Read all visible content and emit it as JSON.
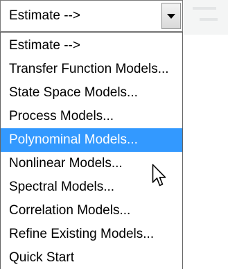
{
  "combo": {
    "value": "Estimate -->",
    "button_icon": "chevron-down-icon"
  },
  "dropdown": {
    "items": [
      {
        "label": "Estimate -->"
      },
      {
        "label": "Transfer Function Models..."
      },
      {
        "label": "State Space Models..."
      },
      {
        "label": "Process Models..."
      },
      {
        "label": "Polynominal Models...",
        "highlighted": true
      },
      {
        "label": "Nonlinear Models..."
      },
      {
        "label": "Spectral Models..."
      },
      {
        "label": "Correlation Models..."
      },
      {
        "label": "Refine Existing Models..."
      },
      {
        "label": "Quick Start"
      }
    ]
  },
  "cursor": {
    "icon": "mouse-pointer-icon"
  },
  "colors": {
    "highlight": "#3399ff",
    "highlight_text": "#ffffff",
    "text": "#000000"
  }
}
